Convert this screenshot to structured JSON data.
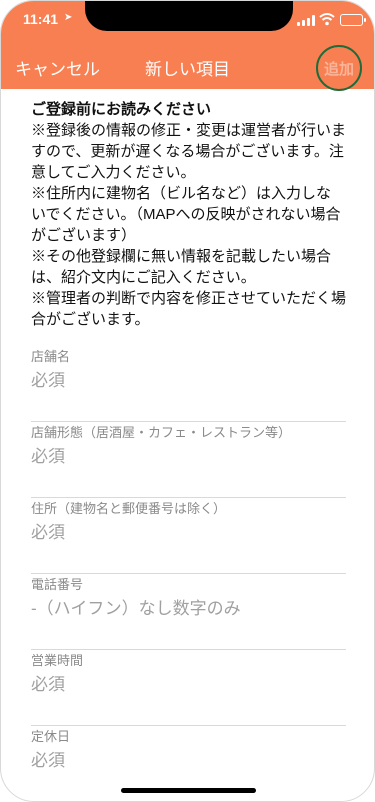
{
  "status_bar": {
    "time": "11:41",
    "location_icon": "location-arrow-icon",
    "signal_icon": "cellular-signal-icon",
    "wifi_icon": "wifi-icon",
    "battery_icon": "battery-icon"
  },
  "nav": {
    "cancel_label": "キャンセル",
    "title": "新しい項目",
    "add_label": "追加",
    "bar_color": "#f77f52",
    "add_color": "#f9b59a"
  },
  "notice": {
    "title": "ご登録前にお読みください",
    "lines": [
      "※登録後の情報の修正・変更は運営者が行いますので、更新が遅くなる場合がございます。注意してご入力ください。",
      "※住所内に建物名（ビル名など）は入力しないでください。（MAPへの反映がされない場合がございます）",
      "※その他登録欄に無い情報を記載したい場合は、紹介文内にご記入ください。",
      "※管理者の判断で内容を修正させていただく場合がございます。"
    ]
  },
  "fields": [
    {
      "label": "店舗名",
      "placeholder": "必須",
      "value": ""
    },
    {
      "label": "店舗形態（居酒屋・カフェ・レストラン等）",
      "placeholder": "必須",
      "value": ""
    },
    {
      "label": "住所（建物名と郵便番号は除く）",
      "placeholder": "必須",
      "value": ""
    },
    {
      "label": "電話番号",
      "placeholder": "-（ハイフン）なし数字のみ",
      "value": ""
    },
    {
      "label": "営業時間",
      "placeholder": "必須",
      "value": ""
    },
    {
      "label": "定休日",
      "placeholder": "必須",
      "value": ""
    }
  ]
}
